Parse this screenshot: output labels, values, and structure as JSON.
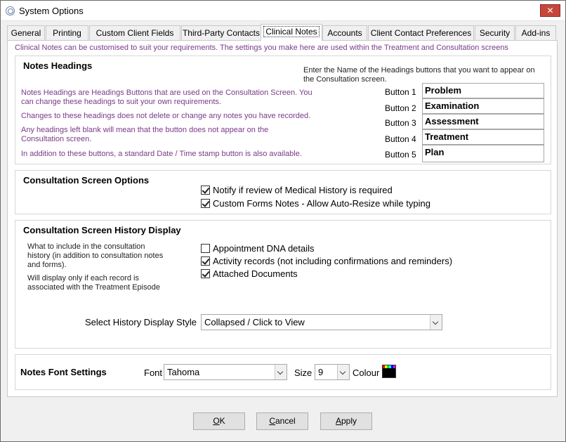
{
  "window": {
    "title": "System Options",
    "close_glyph": "✕"
  },
  "tabs": [
    {
      "label": "General"
    },
    {
      "label": "Printing"
    },
    {
      "label": "Custom Client Fields"
    },
    {
      "label": "Third-Party Contacts"
    },
    {
      "label": "Clinical Notes",
      "active": true
    },
    {
      "label": "Accounts"
    },
    {
      "label": "Client Contact Preferences"
    },
    {
      "label": "Security"
    },
    {
      "label": "Add-ins"
    }
  ],
  "intro_text": "Clinical Notes can be customised to suit your requirements. The settings you make here are used within the Treatment and Consultation screens",
  "notes_headings": {
    "title": "Notes Headings",
    "instruction": "Enter the Name of the Headings buttons that you want to appear on the Consultation screen.",
    "desc": [
      "Notes Headings are Headings Buttons that are used on the Consultation Screen. You can change these headings to suit your own requirements.",
      "Changes to these headings does not delete or change any notes you have recorded.",
      "Any headings left blank will mean that the button does not appear on the Consultation screen.",
      "In addition to these buttons, a standard Date / Time stamp button is also available."
    ],
    "buttons": [
      {
        "label": "Button 1",
        "value": "Problem"
      },
      {
        "label": "Button 2",
        "value": "Examination"
      },
      {
        "label": "Button 3",
        "value": "Assessment"
      },
      {
        "label": "Button 4",
        "value": "Treatment"
      },
      {
        "label": "Button 5",
        "value": "Plan"
      }
    ]
  },
  "consultation_options": {
    "title": "Consultation Screen Options",
    "checks": [
      {
        "label": "Notify if review of Medical History is required",
        "checked": true
      },
      {
        "label": "Custom Forms Notes - Allow Auto-Resize while typing",
        "checked": true
      }
    ]
  },
  "history_display": {
    "title": "Consultation Screen History Display",
    "desc1": "What to include in the consultation history (in addition to consultation notes and forms).",
    "desc2": "Will display only if each record is associated with the Treatment Episode",
    "checks": [
      {
        "label": "Appointment DNA details",
        "checked": false
      },
      {
        "label": "Activity records (not including confirmations and reminders)",
        "checked": true
      },
      {
        "label": "Attached Documents",
        "checked": true
      }
    ],
    "style_label": "Select History Display Style",
    "style_value": "Collapsed / Click to View"
  },
  "font_settings": {
    "title": "Notes Font Settings",
    "font_label": "Font",
    "font_value": "Tahoma",
    "size_label": "Size",
    "size_value": "9",
    "colour_label": "Colour",
    "colour_value": "#000000"
  },
  "footer": {
    "ok": {
      "mnemonic": "O",
      "rest": "K"
    },
    "cancel": {
      "mnemonic": "C",
      "rest": "ancel"
    },
    "apply": {
      "mnemonic": "A",
      "rest": "pply"
    }
  }
}
